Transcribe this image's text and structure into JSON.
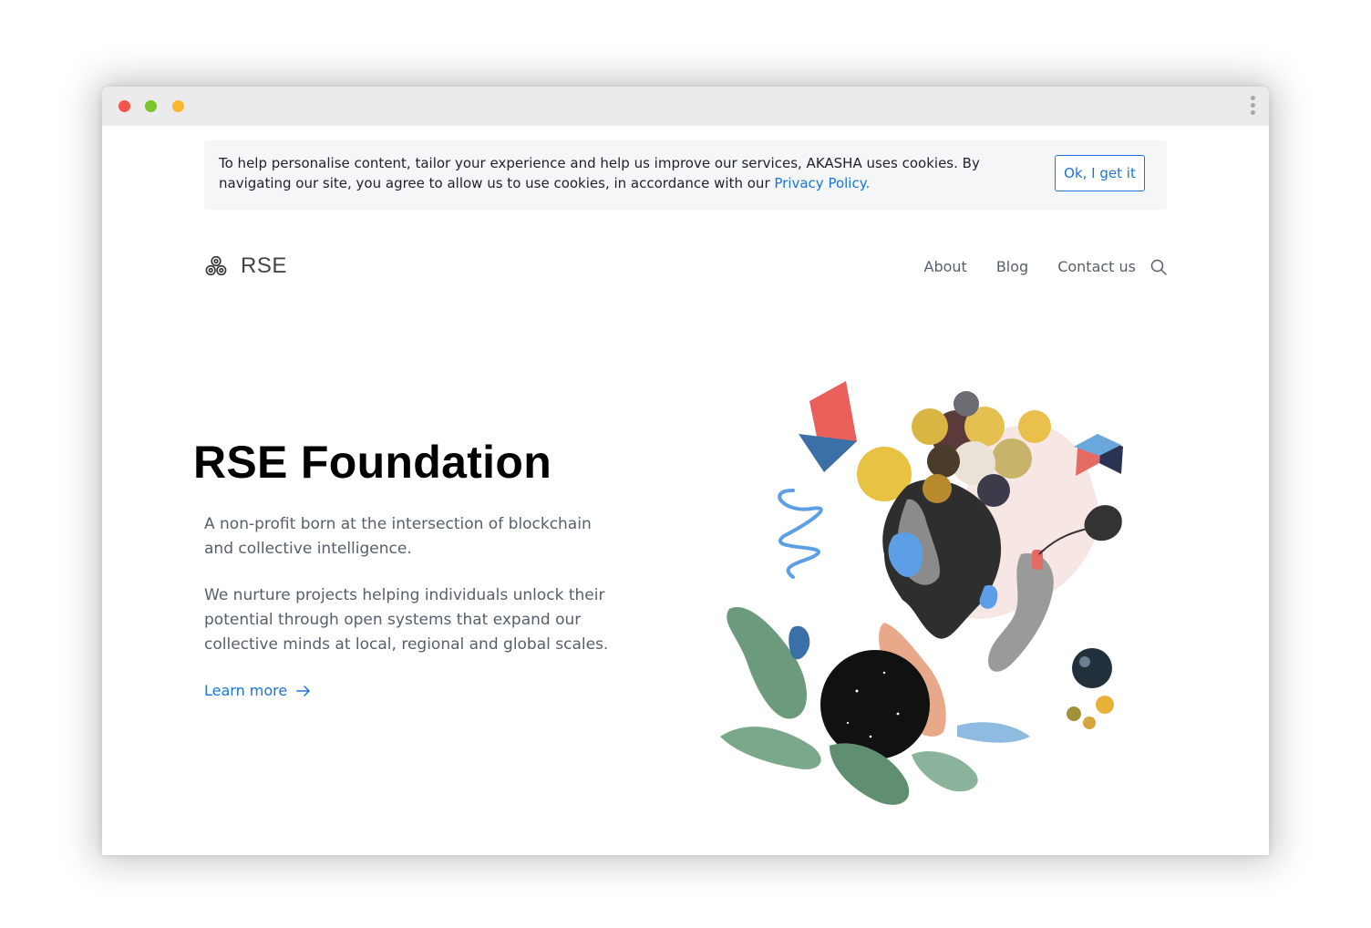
{
  "cookie_banner": {
    "text": "To help personalise content, tailor your experience and help us improve our services, AKASHA uses cookies. By navigating our site, you agree to allow us to use cookies, in accordance with our ",
    "link_text": "Privacy Policy.",
    "button_label": "Ok, I get it"
  },
  "header": {
    "logo_text": "RSE",
    "nav": {
      "about": "About",
      "blog": "Blog",
      "contact": "Contact us"
    }
  },
  "hero": {
    "title": "RSE Foundation",
    "paragraph1": "A non-profit born at the intersection of blockchain and collective intelligence.",
    "paragraph2": "We nurture projects helping individuals unlock their potential through open systems that expand our collective minds at local, regional and global scales.",
    "cta": "Learn more"
  },
  "colors": {
    "accent": "#1b74d8",
    "body_text": "#56606b",
    "banner_bg": "#f5f6f7"
  },
  "icons": {
    "window_menu": "kebab-icon",
    "logo": "triskelion-icon",
    "search": "search-icon",
    "cta": "arrow-right-icon"
  }
}
